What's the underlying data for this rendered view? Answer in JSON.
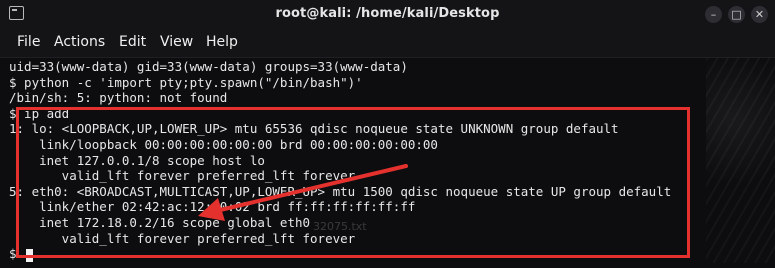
{
  "window": {
    "title": "root@kali: /home/kali/Desktop",
    "controls": {
      "minimize": "–",
      "maximize": "□",
      "close": "✕"
    }
  },
  "menu": {
    "file": "File",
    "actions": "Actions",
    "edit": "Edit",
    "view": "View",
    "help": "Help"
  },
  "terminal": {
    "lines": [
      "uid=33(www-data) gid=33(www-data) groups=33(www-data)",
      "$ python -c 'import pty;pty.spawn(\"/bin/bash\")'",
      "/bin/sh: 5: python: not found",
      "$ ip add",
      "1: lo: <LOOPBACK,UP,LOWER_UP> mtu 65536 qdisc noqueue state UNKNOWN group default",
      "    link/loopback 00:00:00:00:00:00 brd 00:00:00:00:00:00",
      "    inet 127.0.0.1/8 scope host lo",
      "       valid_lft forever preferred_lft forever",
      "5: eth0: <BROADCAST,MULTICAST,UP,LOWER_UP> mtu 1500 qdisc noqueue state UP group default",
      "    link/ether 02:42:ac:12:00:02 brd ff:ff:ff:ff:ff:ff",
      "    inet 172.18.0.2/16 scope global eth0",
      "       valid_lft forever preferred_lft forever",
      "$ "
    ]
  },
  "annotations": {
    "color": "#e5312d",
    "watermark": "32075.txt"
  },
  "colors": {
    "background": "#0d0d10",
    "text": "#e7e7e7",
    "titlebar": "#141417",
    "highlight": "#e5312d"
  }
}
